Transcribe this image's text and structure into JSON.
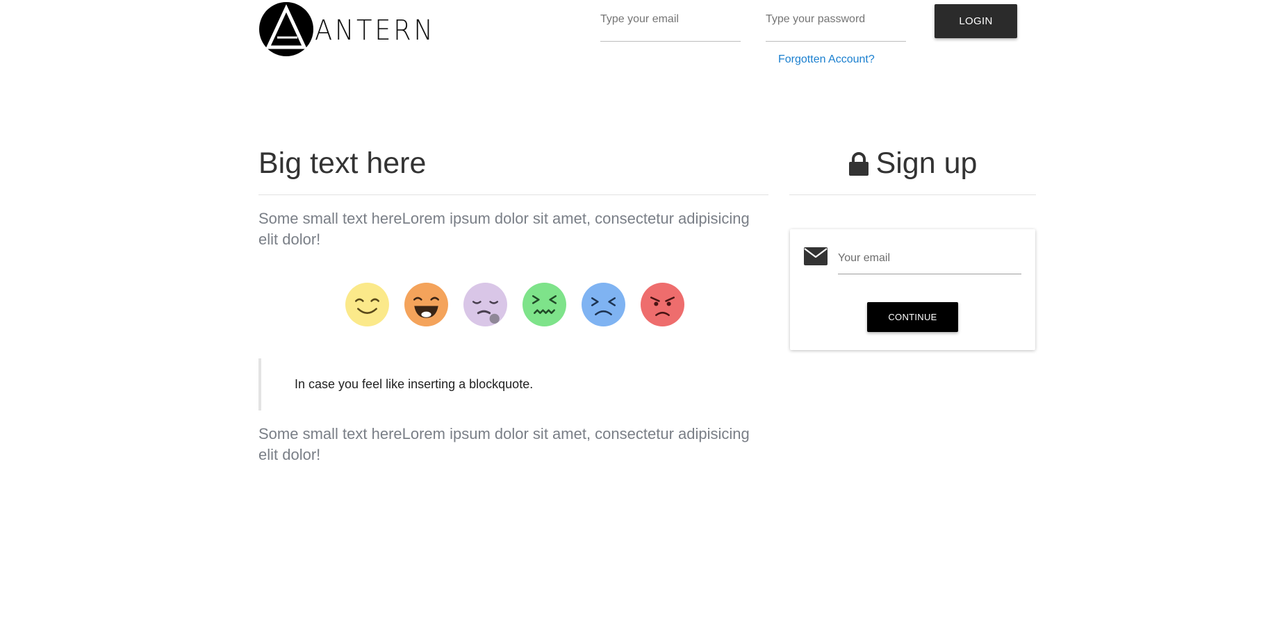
{
  "header": {
    "logo_text": "ANTERN",
    "email_placeholder": "Type your email",
    "password_placeholder": "Type your password",
    "login_label": "LOGIN",
    "forgot_label": "Forgotten Account?",
    "link_color": "#1a7fcf",
    "login_button_color": "#2b2b2b"
  },
  "main": {
    "title": "Big text here",
    "intro_text": "Some small text hereLorem ipsum dolor sit amet, consectetur adipisicing elit dolor!",
    "emojis": [
      {
        "icon": "smiling-face-icon",
        "color": "#fbe98a"
      },
      {
        "icon": "laughing-face-icon",
        "color": "#f4a35b"
      },
      {
        "icon": "sleepy-face-icon",
        "color": "#d9c6e7"
      },
      {
        "icon": "nauseated-face-icon",
        "color": "#7ee38a"
      },
      {
        "icon": "sad-face-icon",
        "color": "#7fb3f2"
      },
      {
        "icon": "angry-face-icon",
        "color": "#ee6d6d"
      }
    ],
    "blockquote": "In case you feel like inserting a blockquote.",
    "outro_text": "Some small text hereLorem ipsum dolor sit amet, consectetur adipisicing elit dolor!"
  },
  "signup": {
    "title": "Sign up",
    "title_icon": "lock-icon",
    "field_icon": "envelope-icon",
    "email_placeholder": "Your email",
    "continue_label": "CONTINUE",
    "continue_button_color": "#000000"
  }
}
